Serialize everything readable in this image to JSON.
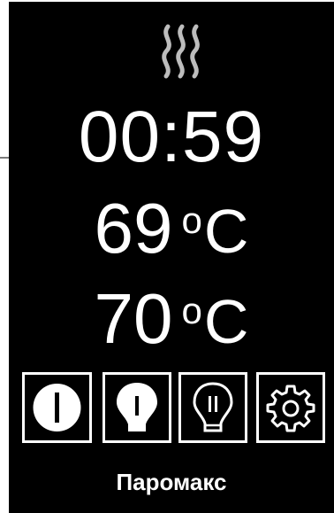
{
  "status": {
    "steam_icon": "steam-waves-icon"
  },
  "display": {
    "timer": "00:59",
    "temp_1_value": "69",
    "temp_2_value": "70",
    "unit_degree": "o",
    "unit_letter": "C"
  },
  "controls": {
    "icons": [
      "power-icon",
      "bulb-icon",
      "bulb-outline-icon",
      "gear-icon"
    ]
  },
  "brand": "Паромакс",
  "colors": {
    "background": "#000000",
    "foreground": "#ffffff",
    "steam": "#bdbdbd"
  }
}
